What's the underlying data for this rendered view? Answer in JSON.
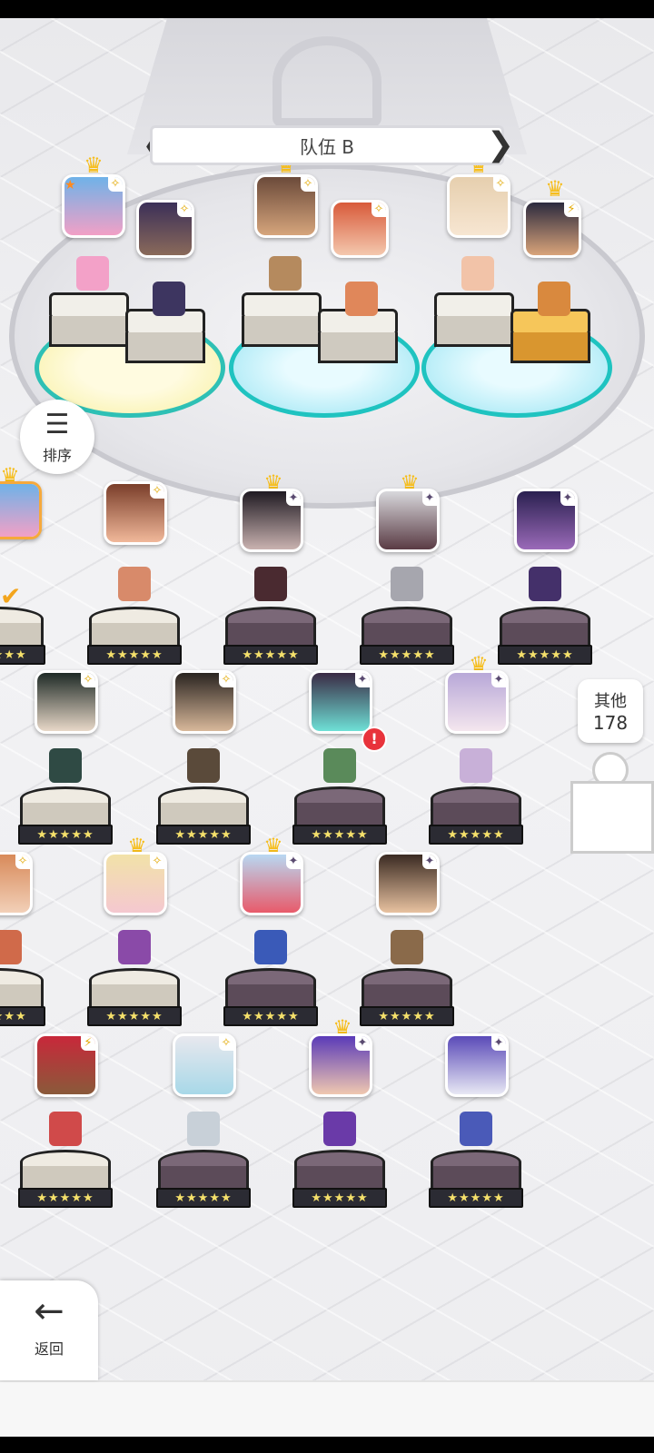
{
  "team": {
    "title": "队伍 B",
    "prev_icon": "chevron-left-icon",
    "next_icon": "chevron-right-icon"
  },
  "sort": {
    "label": "排序",
    "icon": "sort-descending-icon"
  },
  "others": {
    "label": "其他",
    "count": "178"
  },
  "back": {
    "label": "返回",
    "icon": "arrow-left-icon"
  },
  "rating": {
    "stars": "★★★★★"
  },
  "alert_glyph": "!",
  "crown_glyph": "♛",
  "colors": {
    "glow": "#1fc3c0",
    "crown": "#f6bd1b",
    "alert": "#e8333b",
    "gold_pedestal": "#f6c65a"
  }
}
